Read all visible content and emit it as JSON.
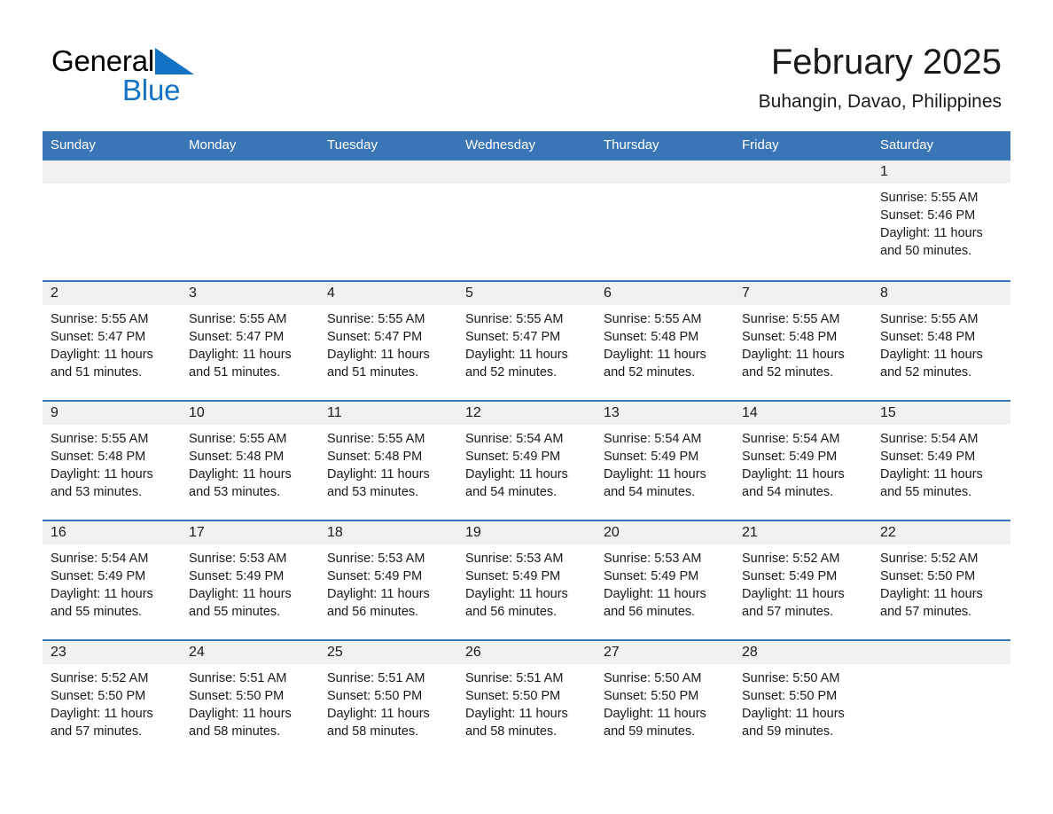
{
  "brand": {
    "name_part1": "General",
    "name_part2": "Blue",
    "triangle_color": "#1273c4",
    "text_color": "#000000",
    "blue_color": "#1273c4"
  },
  "header": {
    "title": "February 2025",
    "subtitle": "Buhangin, Davao, Philippines"
  },
  "theme": {
    "header_blue": "#3a76b6",
    "date_band_gray": "#f1f1f1",
    "text_color": "#1a1a1a"
  },
  "weekdays": [
    "Sunday",
    "Monday",
    "Tuesday",
    "Wednesday",
    "Thursday",
    "Friday",
    "Saturday"
  ],
  "weeks": [
    [
      {
        "day": "",
        "sunrise": "",
        "sunset": "",
        "daylight": ""
      },
      {
        "day": "",
        "sunrise": "",
        "sunset": "",
        "daylight": ""
      },
      {
        "day": "",
        "sunrise": "",
        "sunset": "",
        "daylight": ""
      },
      {
        "day": "",
        "sunrise": "",
        "sunset": "",
        "daylight": ""
      },
      {
        "day": "",
        "sunrise": "",
        "sunset": "",
        "daylight": ""
      },
      {
        "day": "",
        "sunrise": "",
        "sunset": "",
        "daylight": ""
      },
      {
        "day": "1",
        "sunrise": "Sunrise: 5:55 AM",
        "sunset": "Sunset: 5:46 PM",
        "daylight": "Daylight: 11 hours and 50 minutes."
      }
    ],
    [
      {
        "day": "2",
        "sunrise": "Sunrise: 5:55 AM",
        "sunset": "Sunset: 5:47 PM",
        "daylight": "Daylight: 11 hours and 51 minutes."
      },
      {
        "day": "3",
        "sunrise": "Sunrise: 5:55 AM",
        "sunset": "Sunset: 5:47 PM",
        "daylight": "Daylight: 11 hours and 51 minutes."
      },
      {
        "day": "4",
        "sunrise": "Sunrise: 5:55 AM",
        "sunset": "Sunset: 5:47 PM",
        "daylight": "Daylight: 11 hours and 51 minutes."
      },
      {
        "day": "5",
        "sunrise": "Sunrise: 5:55 AM",
        "sunset": "Sunset: 5:47 PM",
        "daylight": "Daylight: 11 hours and 52 minutes."
      },
      {
        "day": "6",
        "sunrise": "Sunrise: 5:55 AM",
        "sunset": "Sunset: 5:48 PM",
        "daylight": "Daylight: 11 hours and 52 minutes."
      },
      {
        "day": "7",
        "sunrise": "Sunrise: 5:55 AM",
        "sunset": "Sunset: 5:48 PM",
        "daylight": "Daylight: 11 hours and 52 minutes."
      },
      {
        "day": "8",
        "sunrise": "Sunrise: 5:55 AM",
        "sunset": "Sunset: 5:48 PM",
        "daylight": "Daylight: 11 hours and 52 minutes."
      }
    ],
    [
      {
        "day": "9",
        "sunrise": "Sunrise: 5:55 AM",
        "sunset": "Sunset: 5:48 PM",
        "daylight": "Daylight: 11 hours and 53 minutes."
      },
      {
        "day": "10",
        "sunrise": "Sunrise: 5:55 AM",
        "sunset": "Sunset: 5:48 PM",
        "daylight": "Daylight: 11 hours and 53 minutes."
      },
      {
        "day": "11",
        "sunrise": "Sunrise: 5:55 AM",
        "sunset": "Sunset: 5:48 PM",
        "daylight": "Daylight: 11 hours and 53 minutes."
      },
      {
        "day": "12",
        "sunrise": "Sunrise: 5:54 AM",
        "sunset": "Sunset: 5:49 PM",
        "daylight": "Daylight: 11 hours and 54 minutes."
      },
      {
        "day": "13",
        "sunrise": "Sunrise: 5:54 AM",
        "sunset": "Sunset: 5:49 PM",
        "daylight": "Daylight: 11 hours and 54 minutes."
      },
      {
        "day": "14",
        "sunrise": "Sunrise: 5:54 AM",
        "sunset": "Sunset: 5:49 PM",
        "daylight": "Daylight: 11 hours and 54 minutes."
      },
      {
        "day": "15",
        "sunrise": "Sunrise: 5:54 AM",
        "sunset": "Sunset: 5:49 PM",
        "daylight": "Daylight: 11 hours and 55 minutes."
      }
    ],
    [
      {
        "day": "16",
        "sunrise": "Sunrise: 5:54 AM",
        "sunset": "Sunset: 5:49 PM",
        "daylight": "Daylight: 11 hours and 55 minutes."
      },
      {
        "day": "17",
        "sunrise": "Sunrise: 5:53 AM",
        "sunset": "Sunset: 5:49 PM",
        "daylight": "Daylight: 11 hours and 55 minutes."
      },
      {
        "day": "18",
        "sunrise": "Sunrise: 5:53 AM",
        "sunset": "Sunset: 5:49 PM",
        "daylight": "Daylight: 11 hours and 56 minutes."
      },
      {
        "day": "19",
        "sunrise": "Sunrise: 5:53 AM",
        "sunset": "Sunset: 5:49 PM",
        "daylight": "Daylight: 11 hours and 56 minutes."
      },
      {
        "day": "20",
        "sunrise": "Sunrise: 5:53 AM",
        "sunset": "Sunset: 5:49 PM",
        "daylight": "Daylight: 11 hours and 56 minutes."
      },
      {
        "day": "21",
        "sunrise": "Sunrise: 5:52 AM",
        "sunset": "Sunset: 5:49 PM",
        "daylight": "Daylight: 11 hours and 57 minutes."
      },
      {
        "day": "22",
        "sunrise": "Sunrise: 5:52 AM",
        "sunset": "Sunset: 5:50 PM",
        "daylight": "Daylight: 11 hours and 57 minutes."
      }
    ],
    [
      {
        "day": "23",
        "sunrise": "Sunrise: 5:52 AM",
        "sunset": "Sunset: 5:50 PM",
        "daylight": "Daylight: 11 hours and 57 minutes."
      },
      {
        "day": "24",
        "sunrise": "Sunrise: 5:51 AM",
        "sunset": "Sunset: 5:50 PM",
        "daylight": "Daylight: 11 hours and 58 minutes."
      },
      {
        "day": "25",
        "sunrise": "Sunrise: 5:51 AM",
        "sunset": "Sunset: 5:50 PM",
        "daylight": "Daylight: 11 hours and 58 minutes."
      },
      {
        "day": "26",
        "sunrise": "Sunrise: 5:51 AM",
        "sunset": "Sunset: 5:50 PM",
        "daylight": "Daylight: 11 hours and 58 minutes."
      },
      {
        "day": "27",
        "sunrise": "Sunrise: 5:50 AM",
        "sunset": "Sunset: 5:50 PM",
        "daylight": "Daylight: 11 hours and 59 minutes."
      },
      {
        "day": "28",
        "sunrise": "Sunrise: 5:50 AM",
        "sunset": "Sunset: 5:50 PM",
        "daylight": "Daylight: 11 hours and 59 minutes."
      },
      {
        "day": "",
        "sunrise": "",
        "sunset": "",
        "daylight": ""
      }
    ]
  ]
}
